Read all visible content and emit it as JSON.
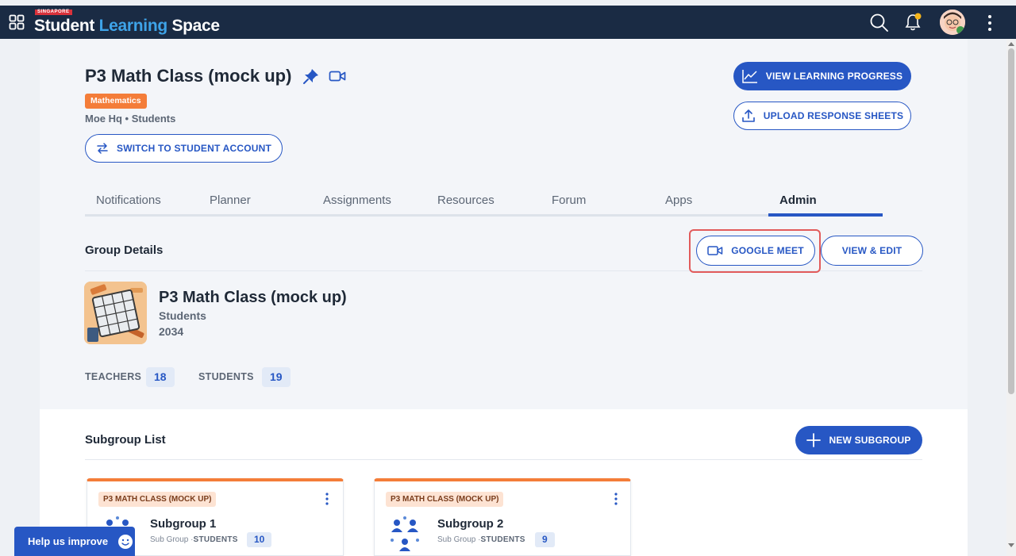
{
  "topbar": {
    "brand_tag": "SINGAPORE",
    "brand_word1": "Student",
    "brand_word2": "Learning",
    "brand_word3": "Space"
  },
  "header": {
    "class_title": "P3 Math Class (mock up)",
    "subject": "Mathematics",
    "meta": "Moe Hq • Students",
    "switch_account_label": "SWITCH TO STUDENT ACCOUNT",
    "view_progress_label": "VIEW LEARNING PROGRESS",
    "upload_sheets_label": "UPLOAD RESPONSE SHEETS"
  },
  "tabs": [
    {
      "label": "Notifications",
      "active": false
    },
    {
      "label": "Planner",
      "active": false
    },
    {
      "label": "Assignments",
      "active": false
    },
    {
      "label": "Resources",
      "active": false
    },
    {
      "label": "Forum",
      "active": false
    },
    {
      "label": "Apps",
      "active": false
    },
    {
      "label": "Admin",
      "active": true
    }
  ],
  "group_details": {
    "section_title": "Group Details",
    "google_meet_label": "GOOGLE MEET",
    "view_edit_label": "VIEW & EDIT",
    "name": "P3 Math Class (mock up)",
    "type": "Students",
    "year": "2034",
    "teachers_label": "TEACHERS",
    "teachers_count": "18",
    "students_label": "STUDENTS",
    "students_count": "19"
  },
  "subgroups": {
    "section_title": "Subgroup List",
    "new_subgroup_label": "NEW SUBGROUP",
    "items": [
      {
        "parent": "P3 MATH CLASS (MOCK UP)",
        "name": "Subgroup 1",
        "kind": "Sub Group ·",
        "students_label": "STUDENTS",
        "count": "10"
      },
      {
        "parent": "P3 MATH CLASS (MOCK UP)",
        "name": "Subgroup 2",
        "kind": "Sub Group ·",
        "students_label": "STUDENTS",
        "count": "9"
      }
    ]
  },
  "help_button_label": "Help us improve",
  "colors": {
    "navbar": "#1a2b44",
    "primary": "#2757c4",
    "subject_tag": "#f47d39",
    "highlight_border": "#e25b5b"
  }
}
